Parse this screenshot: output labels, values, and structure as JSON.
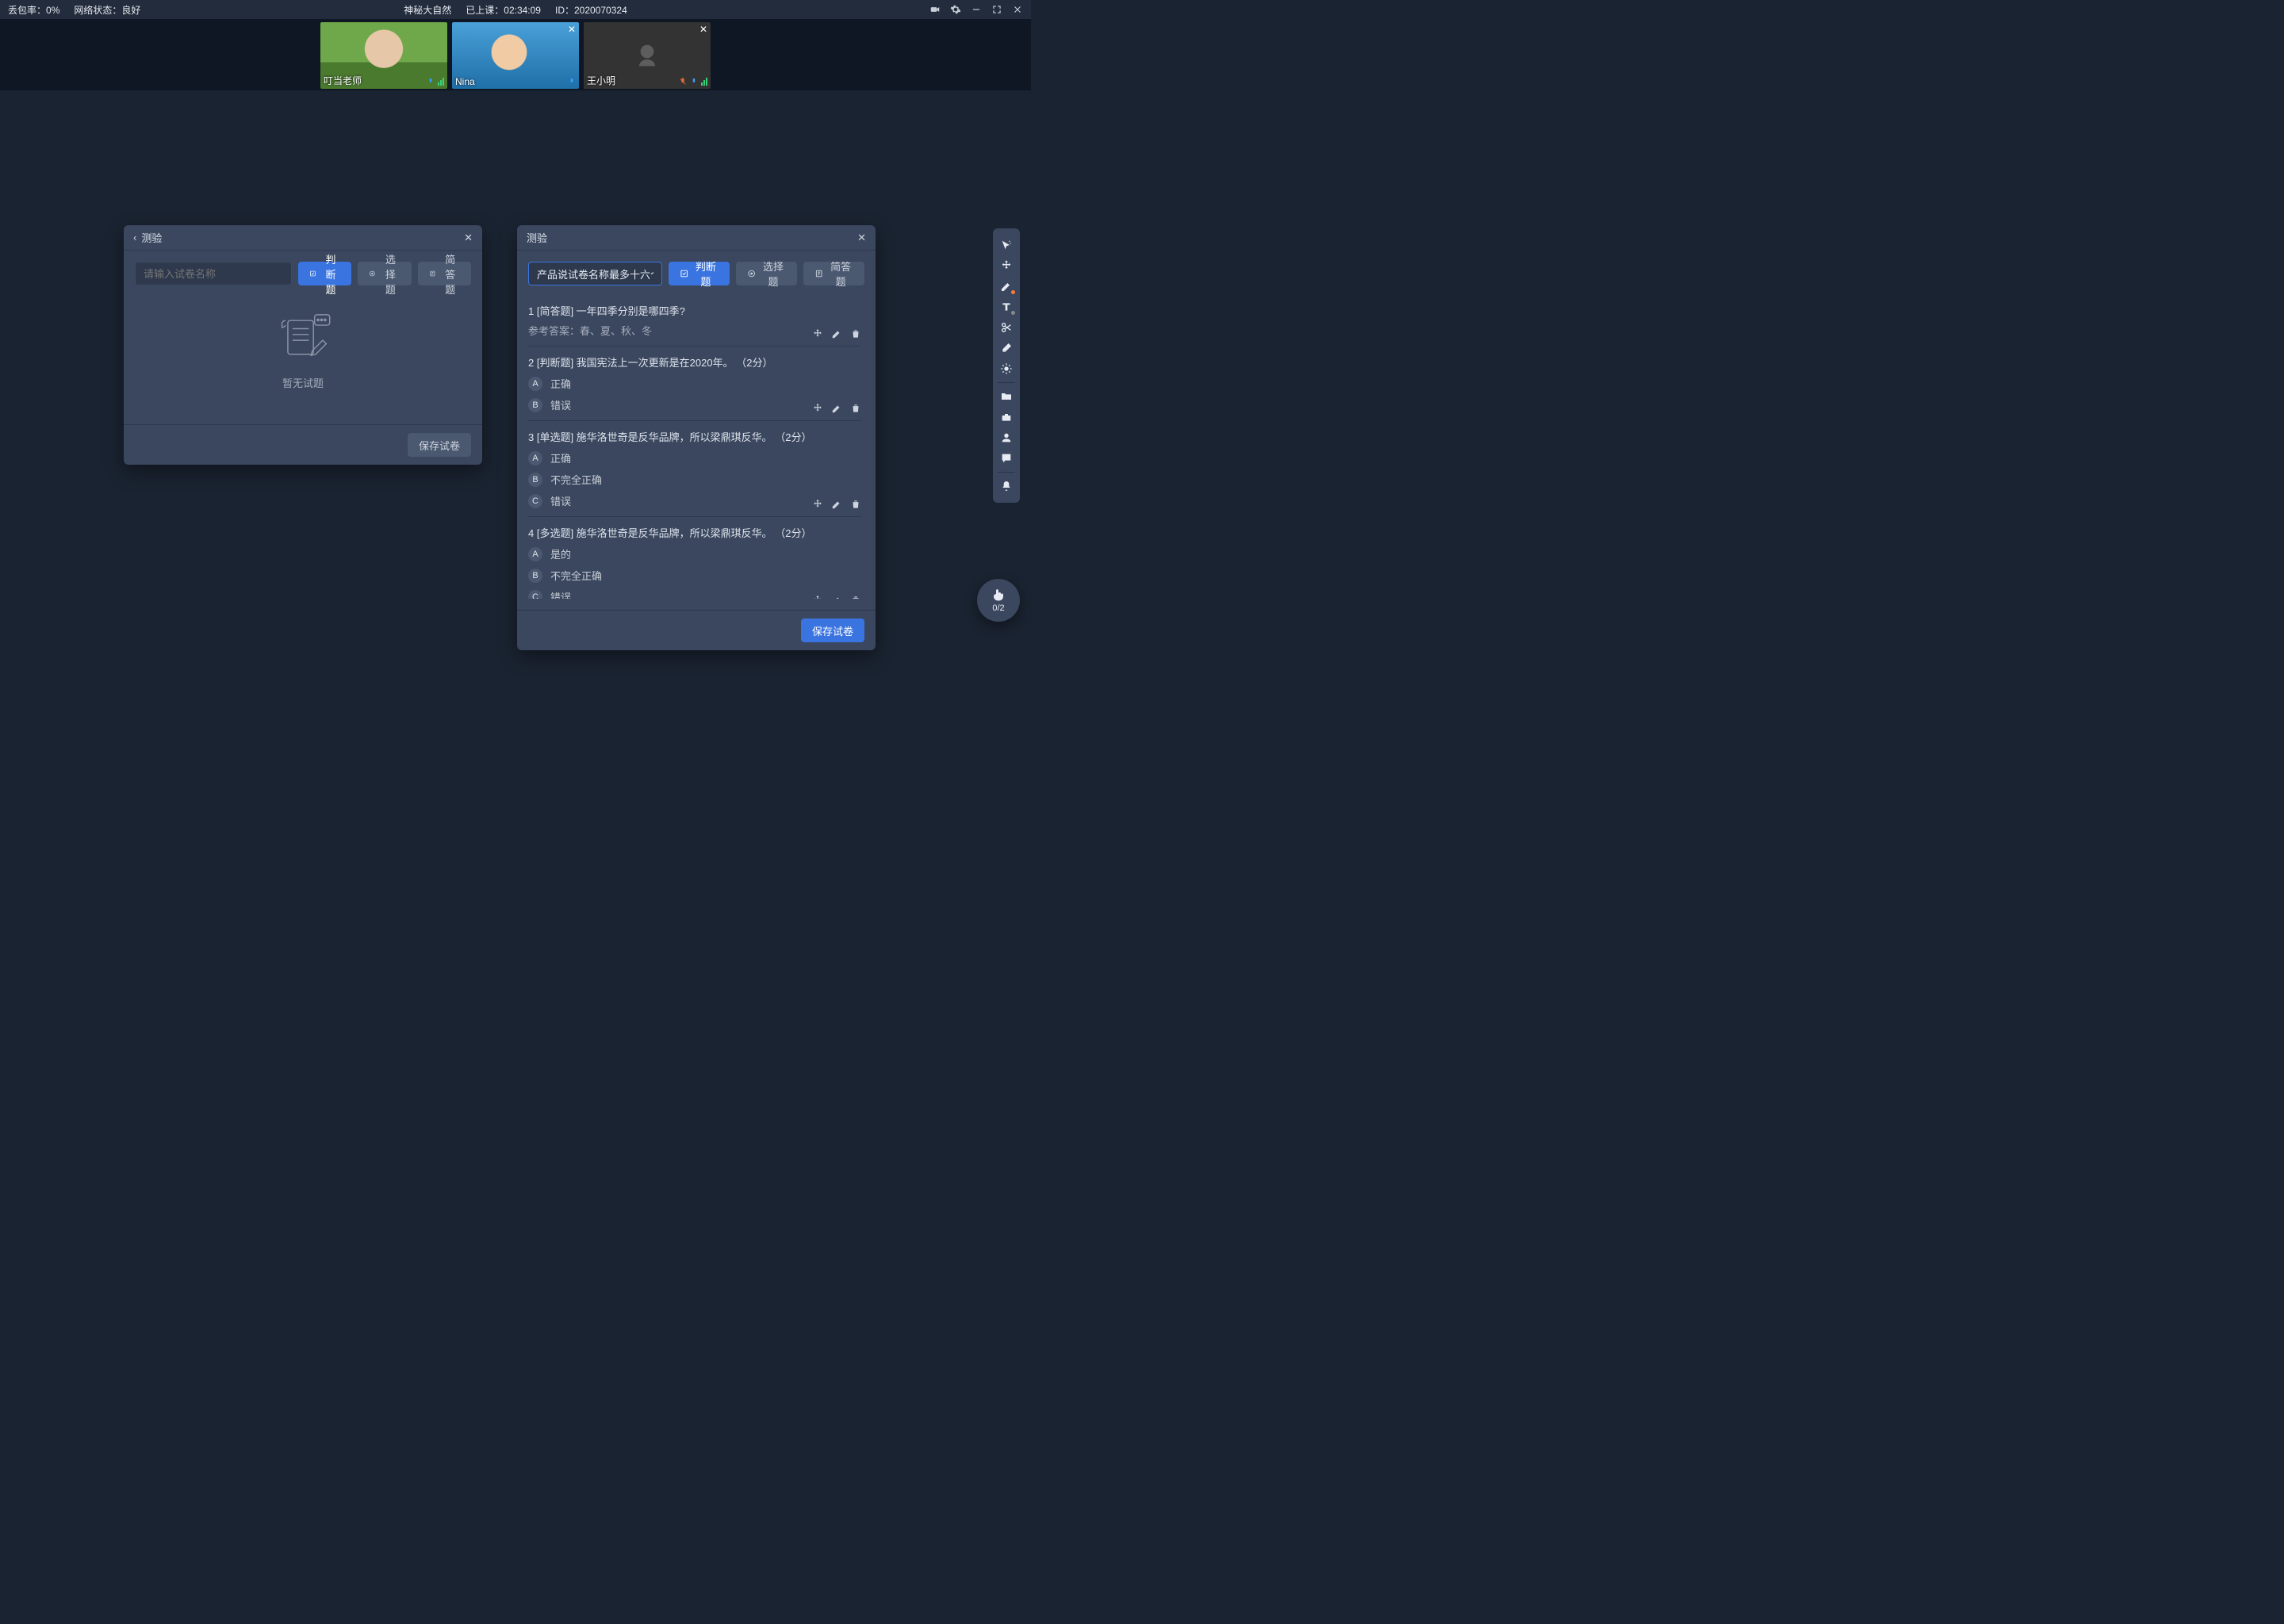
{
  "topbar": {
    "loss_label": "丢包率：",
    "loss_value": "0%",
    "net_label": "网络状态：",
    "net_value": "良好",
    "title": "神秘大自然",
    "elapsed_label": "已上课：",
    "elapsed_value": "02:34:09",
    "id_label": "ID：",
    "id_value": "2020070324"
  },
  "videos": [
    {
      "name": "叮当老师",
      "camera_off": false,
      "face": "f1",
      "has_close": false,
      "mic": "on",
      "has_signal": true
    },
    {
      "name": "Nina",
      "camera_off": false,
      "face": "f2",
      "has_close": true,
      "mic": "on",
      "has_signal": false
    },
    {
      "name": "王小明",
      "camera_off": true,
      "face": "",
      "has_close": true,
      "mic": "muted",
      "has_signal": true
    }
  ],
  "panel_left": {
    "title": "测验",
    "input_placeholder": "请输入试卷名称",
    "btn_judge": "判断题",
    "btn_choice": "选择题",
    "btn_short": "简答题",
    "empty_text": "暂无试题",
    "save_btn": "保存试卷"
  },
  "panel_right": {
    "title": "测验",
    "input_value": "产品说试卷名称最多十六个字",
    "btn_judge": "判断题",
    "btn_choice": "选择题",
    "btn_short": "简答题",
    "save_btn": "保存试卷",
    "questions": [
      {
        "num": "1",
        "tag": "[简答题]",
        "text": "一年四季分别是哪四季?",
        "sub_label": "参考答案：",
        "sub_value": "春、夏、秋、冬",
        "options": []
      },
      {
        "num": "2",
        "tag": "[判断题]",
        "text": "我国宪法上一次更新是在2020年。",
        "points": "（2分）",
        "options": [
          {
            "letter": "A",
            "text": "正确"
          },
          {
            "letter": "B",
            "text": "错误"
          }
        ]
      },
      {
        "num": "3",
        "tag": "[单选题]",
        "text": "施华洛世奇是反华品牌，所以梁鼎琪反华。",
        "points": "（2分）",
        "options": [
          {
            "letter": "A",
            "text": "正确"
          },
          {
            "letter": "B",
            "text": "不完全正确"
          },
          {
            "letter": "C",
            "text": "错误"
          }
        ]
      },
      {
        "num": "4",
        "tag": "[多选题]",
        "text": "施华洛世奇是反华品牌，所以梁鼎琪反华。",
        "points": "（2分）",
        "options": [
          {
            "letter": "A",
            "text": "是的"
          },
          {
            "letter": "B",
            "text": "不完全正确"
          },
          {
            "letter": "C",
            "text": "错误"
          }
        ]
      }
    ]
  },
  "hand_badge": {
    "count": "0/2"
  },
  "toolbar_icons": [
    "pointer-sparkle",
    "move",
    "pen",
    "text",
    "scissors",
    "eraser",
    "brightness",
    "divider",
    "folder",
    "toolbox",
    "person",
    "chat",
    "divider",
    "bell"
  ]
}
